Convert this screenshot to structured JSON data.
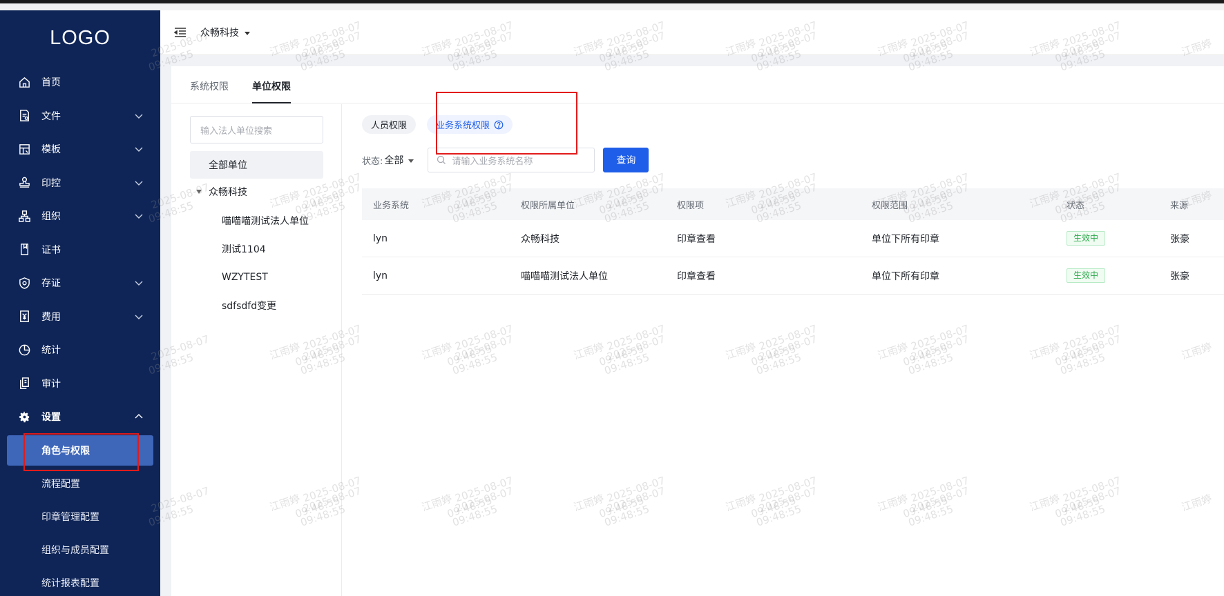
{
  "sidebar": {
    "logo": "LOGO",
    "items": [
      {
        "label": "首页",
        "icon": "home-icon"
      },
      {
        "label": "文件",
        "icon": "file-icon",
        "expandable": true
      },
      {
        "label": "模板",
        "icon": "template-icon",
        "expandable": true
      },
      {
        "label": "印控",
        "icon": "stamp-icon",
        "expandable": true
      },
      {
        "label": "组织",
        "icon": "org-icon",
        "expandable": true
      },
      {
        "label": "证书",
        "icon": "certificate-icon"
      },
      {
        "label": "存证",
        "icon": "shield-icon",
        "expandable": true
      },
      {
        "label": "费用",
        "icon": "fee-icon",
        "expandable": true
      },
      {
        "label": "统计",
        "icon": "pie-chart-icon"
      },
      {
        "label": "审计",
        "icon": "audit-icon"
      },
      {
        "label": "设置",
        "icon": "gear-icon",
        "expanded": true
      }
    ],
    "settings_sub": [
      {
        "label": "角色与权限",
        "selected": true
      },
      {
        "label": "流程配置"
      },
      {
        "label": "印章管理配置"
      },
      {
        "label": "组织与成员配置"
      },
      {
        "label": "统计报表配置"
      }
    ]
  },
  "header": {
    "org_name": "众畅科技"
  },
  "tabs": [
    "系统权限",
    "单位权限"
  ],
  "left_pane": {
    "search_placeholder": "输入法人单位搜索",
    "all_units": "全部单位",
    "tree_root": "众畅科技",
    "tree_children": [
      "喵喵喵测试法人单位",
      "测试1104",
      "WZYTEST",
      "sdfsdfd变更"
    ]
  },
  "subtabs": {
    "people": "人员权限",
    "business": "业务系统权限"
  },
  "filter": {
    "status_label": "状态:",
    "status_value": "全部",
    "search_placeholder": "请输入业务系统名称",
    "query_button": "查询"
  },
  "table": {
    "headers": [
      "业务系统",
      "权限所属单位",
      "权限项",
      "权限范围",
      "状态",
      "来源"
    ],
    "rows": [
      [
        "lyn",
        "众畅科技",
        "印章查看",
        "单位下所有印章",
        "生效中",
        "张豪"
      ],
      [
        "lyn",
        "喵喵喵测试法人单位",
        "印章查看",
        "单位下所有印章",
        "生效中",
        "张豪"
      ]
    ]
  },
  "watermark": {
    "name": "江雨婷",
    "date": "2025-08-07",
    "time": "09:48:55"
  },
  "colors": {
    "sidebar_bg": "#0f2557",
    "selected_item": "#3e66b9",
    "primary": "#1f5ee8",
    "status_green": "#2eaa4e",
    "highlight_red": "#e21b1b"
  }
}
